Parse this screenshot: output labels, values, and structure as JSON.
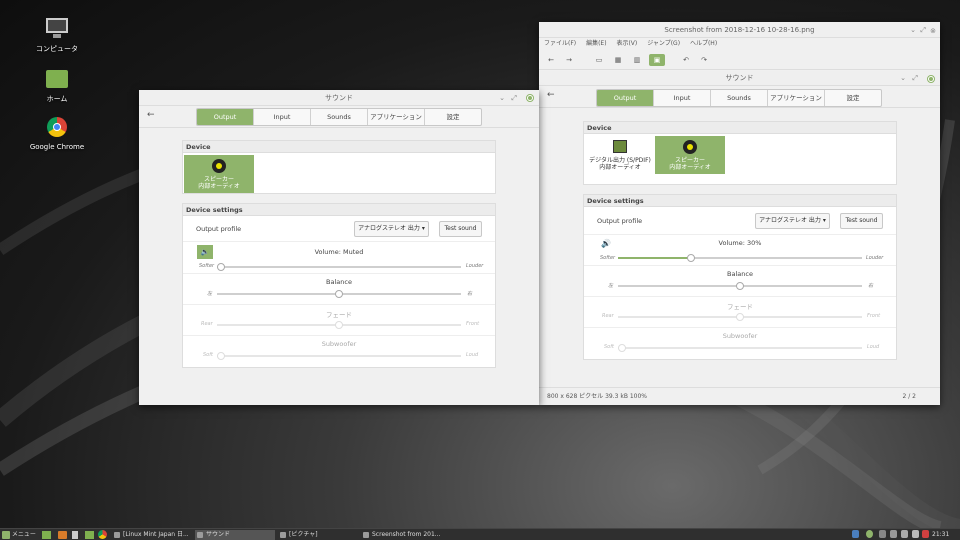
{
  "desktop": {
    "icons": [
      {
        "label": "コンピュータ"
      },
      {
        "label": "ホーム"
      },
      {
        "label": "Google Chrome"
      }
    ]
  },
  "sound_window_left": {
    "title": "サウンド",
    "tabs": [
      "Output",
      "Input",
      "Sounds",
      "アプリケーション",
      "設定"
    ],
    "selected_tab": "Output",
    "device_header": "Device",
    "devices": [
      {
        "line1": "スピーカー",
        "line2": "内部オーディオ",
        "selected": true
      }
    ],
    "settings_header": "Device settings",
    "output_profile_label": "Output profile",
    "output_profile_value": "アナログステレオ 出力",
    "test_sound": "Test sound",
    "volume": {
      "label": "Volume: Muted",
      "value": 0,
      "min_label": "Softer",
      "max_label": "Louder"
    },
    "balance": {
      "label": "Balance",
      "value": 0.5,
      "left": "左",
      "right": "右"
    },
    "fade": {
      "label": "フェード",
      "value": 0.5,
      "left": "Rear",
      "right": "Front"
    },
    "subwoofer": {
      "label": "Subwoofer",
      "value": 0,
      "left": "Soft",
      "right": "Loud"
    }
  },
  "viewer_window": {
    "title": "Screenshot from 2018-12-16 10-28-16.png",
    "menu": [
      "ファイル(F)",
      "編集(E)",
      "表示(V)",
      "ジャンプ(G)",
      "ヘルプ(H)"
    ],
    "status_left": "800 x 628 ピクセル  39.3 kB    100%",
    "status_right": "2 / 2",
    "inner": {
      "title": "サウンド",
      "tabs": [
        "Output",
        "Input",
        "Sounds",
        "アプリケーション",
        "設定"
      ],
      "selected_tab": "Output",
      "device_header": "Device",
      "devices": [
        {
          "line1": "デジタル出力 (S/PDIF)",
          "line2": "内部オーディオ",
          "selected": false
        },
        {
          "line1": "スピーカー",
          "line2": "内部オーディオ",
          "selected": true
        }
      ],
      "settings_header": "Device settings",
      "output_profile_label": "Output profile",
      "output_profile_value": "アナログステレオ 出力",
      "test_sound": "Test sound",
      "volume": {
        "label": "Volume: 30%",
        "value": 0.3,
        "min_label": "Softer",
        "max_label": "Louder"
      },
      "balance": {
        "label": "Balance",
        "value": 0.5,
        "left": "左",
        "right": "右"
      },
      "fade": {
        "label": "フェード",
        "value": 0.5,
        "left": "Rear",
        "right": "Front"
      },
      "subwoofer": {
        "label": "Subwoofer",
        "value": 0,
        "left": "Soft",
        "right": "Loud"
      }
    }
  },
  "taskbar": {
    "menu_label": "メニュー",
    "windows": [
      {
        "label": "[Linux Mint Japan 日..."
      },
      {
        "label": "サウンド"
      },
      {
        "label": "[ピクチャ]"
      },
      {
        "label": "Screenshot from 201..."
      }
    ],
    "clock": "21:31"
  },
  "colors": {
    "accent": "#8fb46b",
    "window_bg": "#f0f0f0",
    "taskbar": "#2f2f2f"
  }
}
